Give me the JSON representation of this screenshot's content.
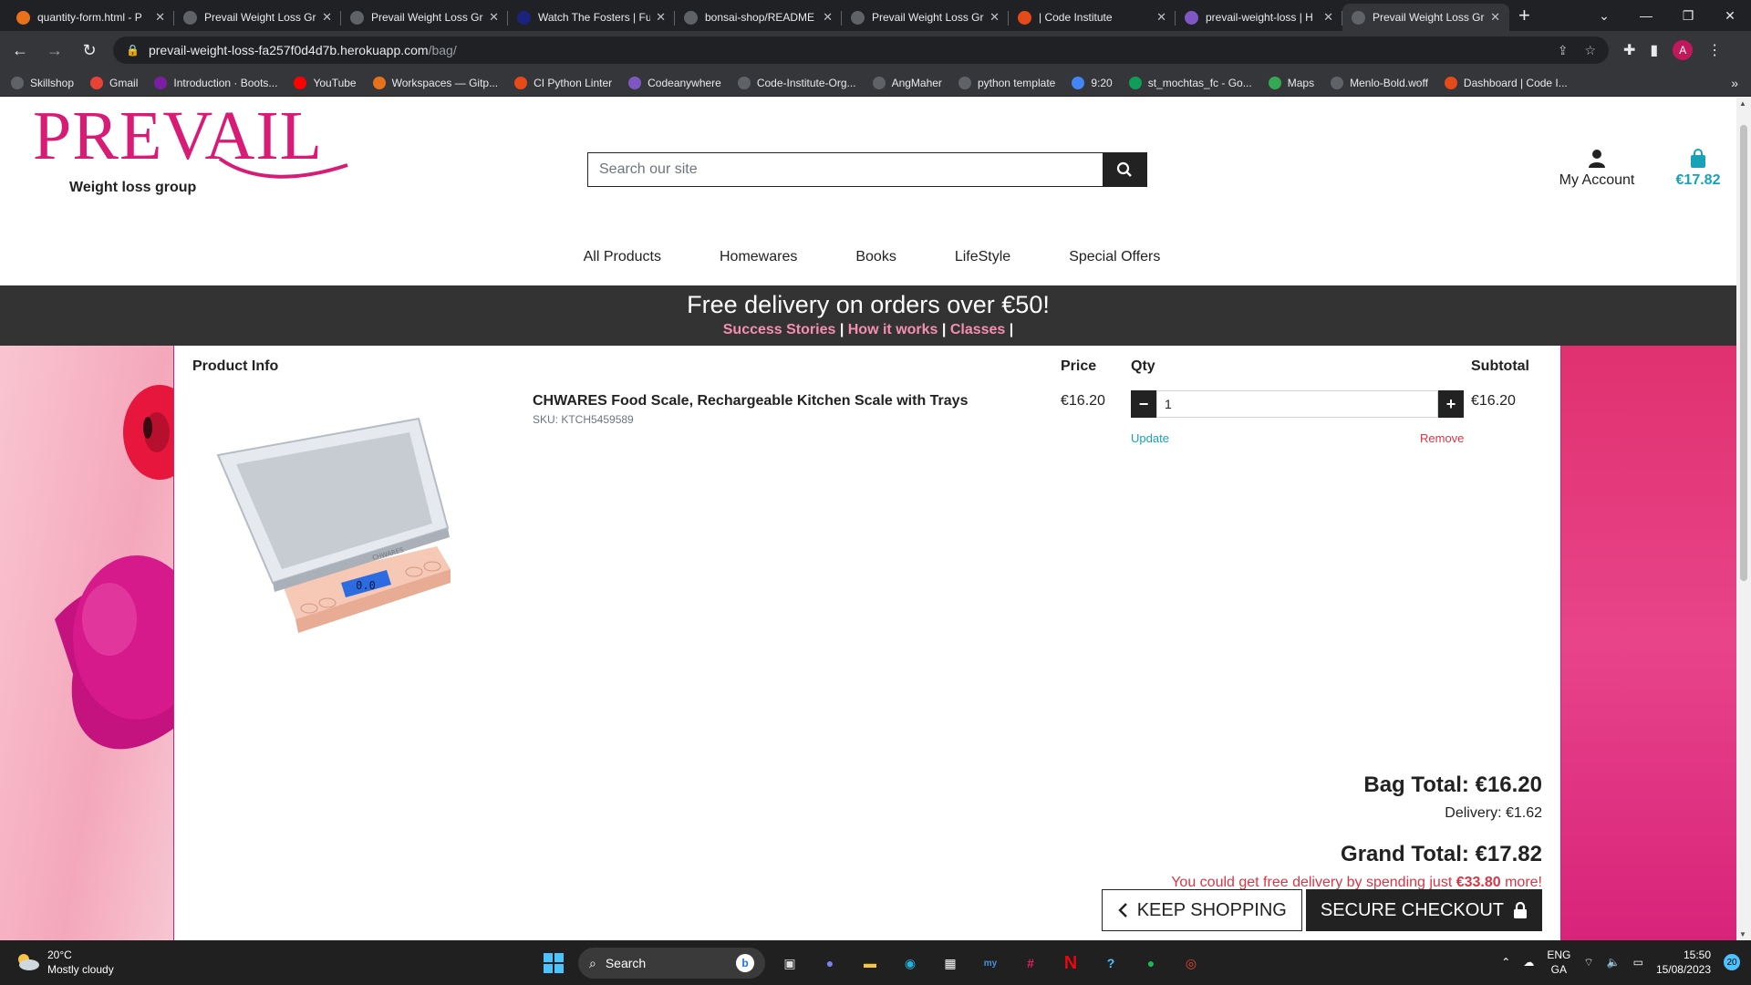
{
  "browser": {
    "tabs": [
      {
        "title": "quantity-form.html - P",
        "icon_color": "#e8711c",
        "icon": "G",
        "active": false
      },
      {
        "title": "Prevail Weight Loss Gr",
        "icon_color": "#5f6368",
        "icon": "globe",
        "active": false
      },
      {
        "title": "Prevail Weight Loss Gr",
        "icon_color": "#5f6368",
        "icon": "globe",
        "active": false
      },
      {
        "title": "Watch The Fosters | Fu",
        "icon_color": "#1a237e",
        "icon": "",
        "active": false
      },
      {
        "title": "bonsai-shop/README",
        "icon_color": "#5f6368",
        "icon": "github",
        "active": false
      },
      {
        "title": "Prevail Weight Loss Gr",
        "icon_color": "#5f6368",
        "icon": "globe",
        "active": false
      },
      {
        "title": "| Code Institute",
        "icon_color": "#e64a19",
        "icon": "",
        "active": false
      },
      {
        "title": "prevail-weight-loss | H",
        "icon_color": "#7e57c2",
        "icon": "H",
        "active": false
      },
      {
        "title": "Prevail Weight Loss Gr",
        "icon_color": "#5f6368",
        "icon": "globe",
        "active": true
      }
    ],
    "url_host": "prevail-weight-loss-fa257f0d4d7b.herokuapp.com",
    "url_path": "/bag/",
    "profile_initial": "A",
    "bookmarks": [
      {
        "label": "Skillshop",
        "color": "#5f6368",
        "icon": ""
      },
      {
        "label": "Gmail",
        "color": "#ea4335",
        "icon": "M"
      },
      {
        "label": "Introduction · Boots...",
        "color": "#7b1fa2",
        "icon": "B"
      },
      {
        "label": "YouTube",
        "color": "#ff0000",
        "icon": "▶"
      },
      {
        "label": "Workspaces — Gitp...",
        "color": "#e8711c",
        "icon": "G"
      },
      {
        "label": "CI Python Linter",
        "color": "#e64a19",
        "icon": ""
      },
      {
        "label": "Codeanywhere",
        "color": "#7e57c2",
        "icon": ""
      },
      {
        "label": "Code-Institute-Org...",
        "color": "#5f6368",
        "icon": ""
      },
      {
        "label": "AngMaher",
        "color": "#5f6368",
        "icon": ""
      },
      {
        "label": "python template",
        "color": "#5f6368",
        "icon": ""
      },
      {
        "label": "9:20",
        "color": "#4285f4",
        "icon": "G"
      },
      {
        "label": "st_mochtas_fc - Go...",
        "color": "#0f9d58",
        "icon": "+"
      },
      {
        "label": "Maps",
        "color": "#34a853",
        "icon": ""
      },
      {
        "label": "Menlo-Bold.woff",
        "color": "#5f6368",
        "icon": ""
      },
      {
        "label": "Dashboard | Code I...",
        "color": "#e64a19",
        "icon": ""
      }
    ]
  },
  "site": {
    "logo_text": "PREVAIL",
    "logo_tagline": "Weight loss group",
    "search_placeholder": "Search our site",
    "account_label": "My Account",
    "bag_total": "€17.82",
    "nav": [
      "All Products",
      "Homewares",
      "Books",
      "LifeStyle",
      "Special Offers"
    ],
    "banner_message": "Free delivery on orders over €50!",
    "banner_links": [
      "Success Stories",
      "How it works",
      "Classes"
    ],
    "accent_color": "#d81b74",
    "info_color": "#17a2b8",
    "danger_color": "#dc3545"
  },
  "bag": {
    "headers": {
      "product": "Product Info",
      "price": "Price",
      "qty": "Qty",
      "subtotal": "Subtotal"
    },
    "item": {
      "name": "CHWARES Food Scale, Rechargeable Kitchen Scale with Trays",
      "sku": "SKU: KTCH5459589",
      "price": "€16.20",
      "quantity": "1",
      "subtotal": "€16.20",
      "update_label": "Update",
      "remove_label": "Remove",
      "scale_display": "0.0",
      "scale_brand": "CHWARES"
    },
    "bag_total": "Bag Total: €16.20",
    "delivery": "Delivery: €1.62",
    "grand_total": "Grand Total: €17.82",
    "free_delivery_prefix": "You could get free delivery by spending just ",
    "free_delivery_amount": "€33.80",
    "free_delivery_suffix": " more!",
    "keep_shopping_label": "KEEP SHOPPING",
    "checkout_label": "SECURE CHECKOUT"
  },
  "taskbar": {
    "weather_temp": "20°C",
    "weather_desc": "Mostly cloudy",
    "search_label": "Search",
    "lang_top": "ENG",
    "lang_bottom": "GA",
    "time": "15:50",
    "date": "15/08/2023",
    "notifications": "20"
  }
}
